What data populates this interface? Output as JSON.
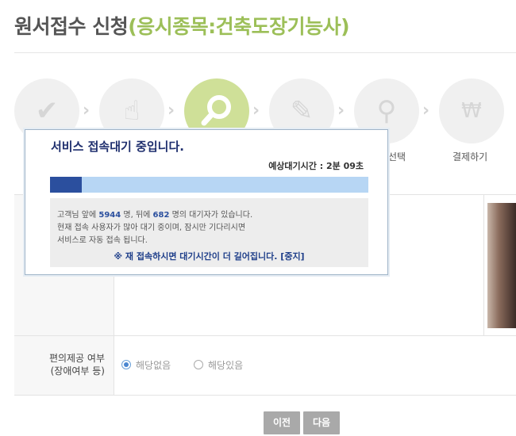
{
  "header": {
    "title": "원서접수 신청",
    "subtitle": "(응시종목:건축도장기능사)"
  },
  "steps": [
    {
      "icon": "check-icon",
      "active": false
    },
    {
      "icon": "touch-icon",
      "active": false
    },
    {
      "icon": "search-icon",
      "active": true
    },
    {
      "icon": "pencil-icon",
      "active": false
    },
    {
      "icon": "location-pin-icon",
      "active": false
    },
    {
      "icon": "won-icon",
      "active": false
    }
  ],
  "step_labels": {
    "step5_partial": "선택",
    "step6": "결제하기"
  },
  "accommodation": {
    "label_line1": "편의제공 여부",
    "label_line2": "(장애여부 등)",
    "options": [
      "해당없음",
      "해당있음"
    ],
    "selected": "해당없음"
  },
  "buttons": {
    "prev": "이전",
    "next": "다음"
  },
  "waiting_modal": {
    "title": "서비스 접속대기 중입니다.",
    "estimated_label": "예상대기시간 : ",
    "estimated_value": "2분 09초",
    "progress_fraction": 0.1,
    "line1_prefix": "고객님 앞에 ",
    "ahead": "5944",
    "line1_mid": " 명, 뒤에 ",
    "behind": "682",
    "line1_suffix": " 명의 대기자가 있습니다.",
    "line2": "현재 접속 사용자가 많아 대기 중이며, 잠시만 기다리시면",
    "line3": "서비스로 자동 접속 됩니다.",
    "warning": "※ 재 접속하시면 대기시간이 더 길어집니다. [중지]"
  },
  "colors": {
    "accent_green": "#9cbf58",
    "active_step": "#cfe098",
    "progress_fill": "#2b4f9e",
    "progress_track": "#b7d6f4"
  }
}
